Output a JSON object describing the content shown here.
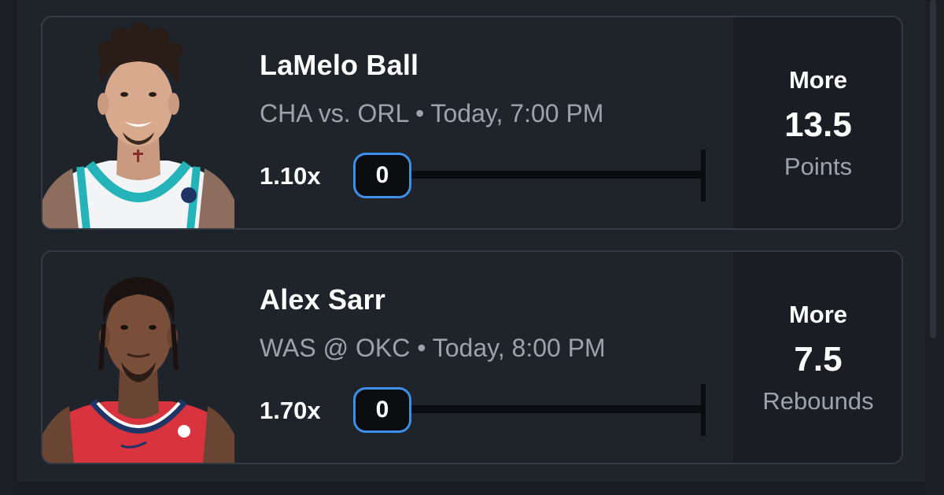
{
  "picks": [
    {
      "player_name": "LaMelo Ball",
      "matchup": "CHA vs. ORL • Today, 7:00 PM",
      "multiplier": "1.10x",
      "progress_count": "0",
      "progress_fraction": 0,
      "pick_type": "More",
      "line": "13.5",
      "stat": "Points",
      "jersey_color": "#ffffff",
      "jersey_trim": "#24b3b8"
    },
    {
      "player_name": "Alex Sarr",
      "matchup": "WAS @ OKC • Today, 8:00 PM",
      "multiplier": "1.70x",
      "progress_count": "0",
      "progress_fraction": 0,
      "pick_type": "More",
      "line": "7.5",
      "stat": "Rebounds",
      "jersey_color": "#d9333f",
      "jersey_trim": "#1f3566"
    }
  ],
  "accent_color": "#3f8fe8"
}
